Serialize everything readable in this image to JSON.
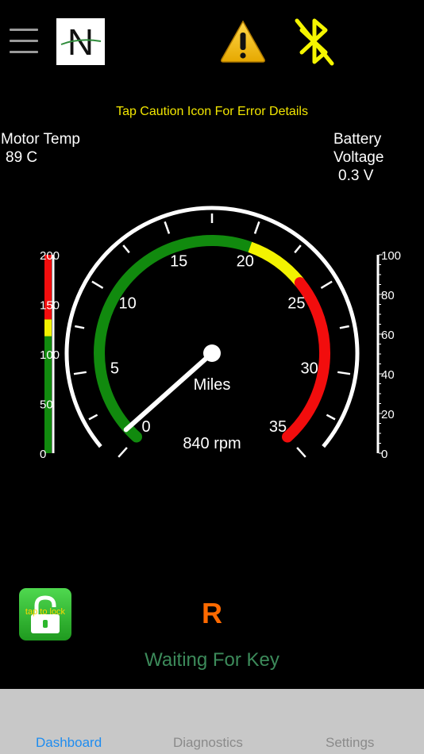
{
  "header": {
    "menu_icon": "hamburger-menu-icon",
    "logo_letter": "N",
    "caution_icon": "warning-triangle-icon",
    "bluetooth_icon": "bluetooth-disabled-icon",
    "colors": {
      "caution": "#f2c300",
      "bluetooth": "#f5f500"
    }
  },
  "caution_message": "Tap Caution Icon For Error Details",
  "motor_temp": {
    "label": "Motor Temp",
    "value": "89 C"
  },
  "battery_voltage": {
    "label_line1": "Battery",
    "label_line2": "Voltage",
    "value": "0.3 V"
  },
  "speedometer": {
    "ticks": [
      "0",
      "5",
      "10",
      "15",
      "20",
      "25",
      "30",
      "35"
    ],
    "unit_label": "Miles",
    "rpm_readout": "840 rpm",
    "needle_value": 0.8,
    "min": 0,
    "max": 35,
    "bands": [
      {
        "from": 0,
        "to": 20,
        "color": "#118a0e"
      },
      {
        "from": 20,
        "to": 24,
        "color": "#f2f200"
      },
      {
        "from": 24,
        "to": 35,
        "color": "#f20d0d"
      }
    ]
  },
  "temp_bar": {
    "ticks": [
      "200",
      "150",
      "100",
      "50",
      "0"
    ],
    "min": 0,
    "max": 200,
    "bands": [
      {
        "from": 0,
        "to": 118,
        "color": "#118a0e"
      },
      {
        "from": 118,
        "to": 135,
        "color": "#f2f200"
      },
      {
        "from": 135,
        "to": 200,
        "color": "#f20d0d"
      }
    ]
  },
  "battery_bar": {
    "ticks": [
      "100",
      "80",
      "60",
      "40",
      "20",
      "0"
    ],
    "min": 0,
    "max": 100,
    "level": 0
  },
  "lock_button": {
    "label": "tap to lock",
    "icon": "unlocked-padlock-icon",
    "color": "#2db82d"
  },
  "gear": {
    "value": "R",
    "color": "#ff6a00"
  },
  "status": "Waiting For Key",
  "tabs": [
    {
      "label": "Dashboard",
      "active": true
    },
    {
      "label": "Diagnostics",
      "active": false
    },
    {
      "label": "Settings",
      "active": false
    }
  ]
}
